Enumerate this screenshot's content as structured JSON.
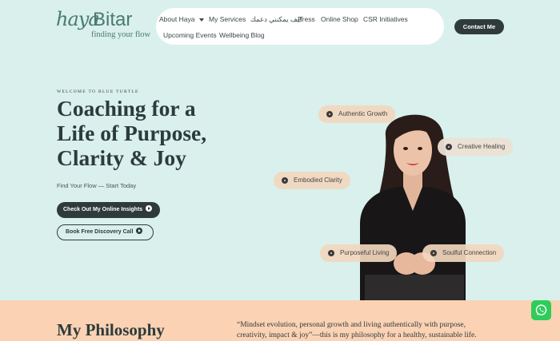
{
  "brand": {
    "script_text": "haya",
    "name": "Bitar",
    "tagline": "finding your flow"
  },
  "nav": {
    "items": [
      {
        "label": "About Haya",
        "has_dropdown": true
      },
      {
        "label": "My Services"
      },
      {
        "label": "كيف يمكنني دعمك"
      },
      {
        "label": "Press"
      },
      {
        "label": "Online Shop"
      },
      {
        "label": "CSR Initiatives"
      },
      {
        "label": "Upcoming Events"
      },
      {
        "label": "Wellbeing Blog"
      }
    ],
    "contact_label": "Contact Me"
  },
  "hero": {
    "eyebrow": "WELCOME TO BLUE TURTLE",
    "title_lines": [
      "Coaching for a",
      "Life of Purpose,",
      "Clarity & Joy"
    ],
    "subtitle": "Find Your Flow — Start Today",
    "primary_cta": "Check Out My Online Insights",
    "secondary_cta": "Book Free Discovery Call"
  },
  "tags": [
    {
      "label": "Authentic Growth"
    },
    {
      "label": "Creative Healing"
    },
    {
      "label": "Embodied Clarity"
    },
    {
      "label": "Purposeful Living"
    },
    {
      "label": "Soulful Connection"
    }
  ],
  "philosophy": {
    "heading": "My Philosophy",
    "quote": "“Mindset evolution, personal growth and living authentically with purpose, creativity, impact & joy”—this is my philosophy for a healthy, sustainable life."
  },
  "icons": {
    "whatsapp": "whatsapp-icon",
    "cta_arrow": "play-circle-icon",
    "tag_bullet": "dot-circle-icon"
  },
  "colors": {
    "page_bg": "#d9f0ec",
    "nav_bg": "#ffffff",
    "dark_button": "#2f3b3b",
    "brand_green": "#4c7a70",
    "tag_bg": "#f2d7be",
    "band_bg": "#fbd2b3",
    "whatsapp_green": "#2ecc5a"
  }
}
